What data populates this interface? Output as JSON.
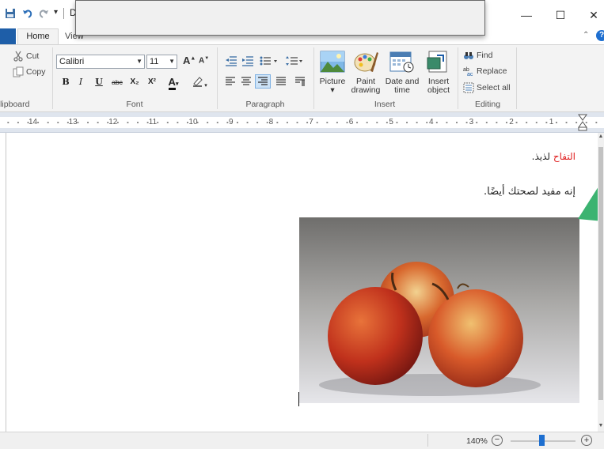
{
  "window": {
    "title_fragment": "D",
    "minimize": "—",
    "maximize": "☐",
    "close": "✕"
  },
  "ribbon_tabs": {
    "home": "Home",
    "view": "View"
  },
  "clipboard": {
    "cut": "Cut",
    "copy": "Copy",
    "group_label": "Clipboard"
  },
  "font": {
    "family": "Calibri",
    "size": "11",
    "bold": "B",
    "italic": "I",
    "underline": "U",
    "strike": "abc",
    "subscript": "X₂",
    "superscript": "X²",
    "color_label": "A",
    "grow": "A",
    "shrink": "A",
    "group_label": "Font"
  },
  "paragraph": {
    "group_label": "Paragraph"
  },
  "insert": {
    "picture": "Picture",
    "paint_drawing_1": "Paint",
    "paint_drawing_2": "drawing",
    "date_time_1": "Date and",
    "date_time_2": "time",
    "insert_object_1": "Insert",
    "insert_object_2": "object",
    "group_label": "Insert"
  },
  "editing": {
    "find": "Find",
    "replace": "Replace",
    "select_all": "Select all",
    "group_label": "Editing"
  },
  "ruler": {
    "numbers": [
      "14",
      "13",
      "12",
      "11",
      "10",
      "9",
      "8",
      "7",
      "6",
      "5",
      "4",
      "3",
      "2",
      "1"
    ]
  },
  "document": {
    "line1_red": "التفاح",
    "line1_black": " لذيذ.",
    "line2": "إنه مفيد لصحتك أيضًا."
  },
  "status": {
    "zoom": "140%",
    "zoom_out": "−",
    "zoom_in": "+",
    "zoom_level": 0.47
  },
  "colors": {
    "accent": "#1e5ea8",
    "red_text": "#e02020",
    "ribbon_bg": "#f3f3f3",
    "green_shape": "#3cb371"
  }
}
